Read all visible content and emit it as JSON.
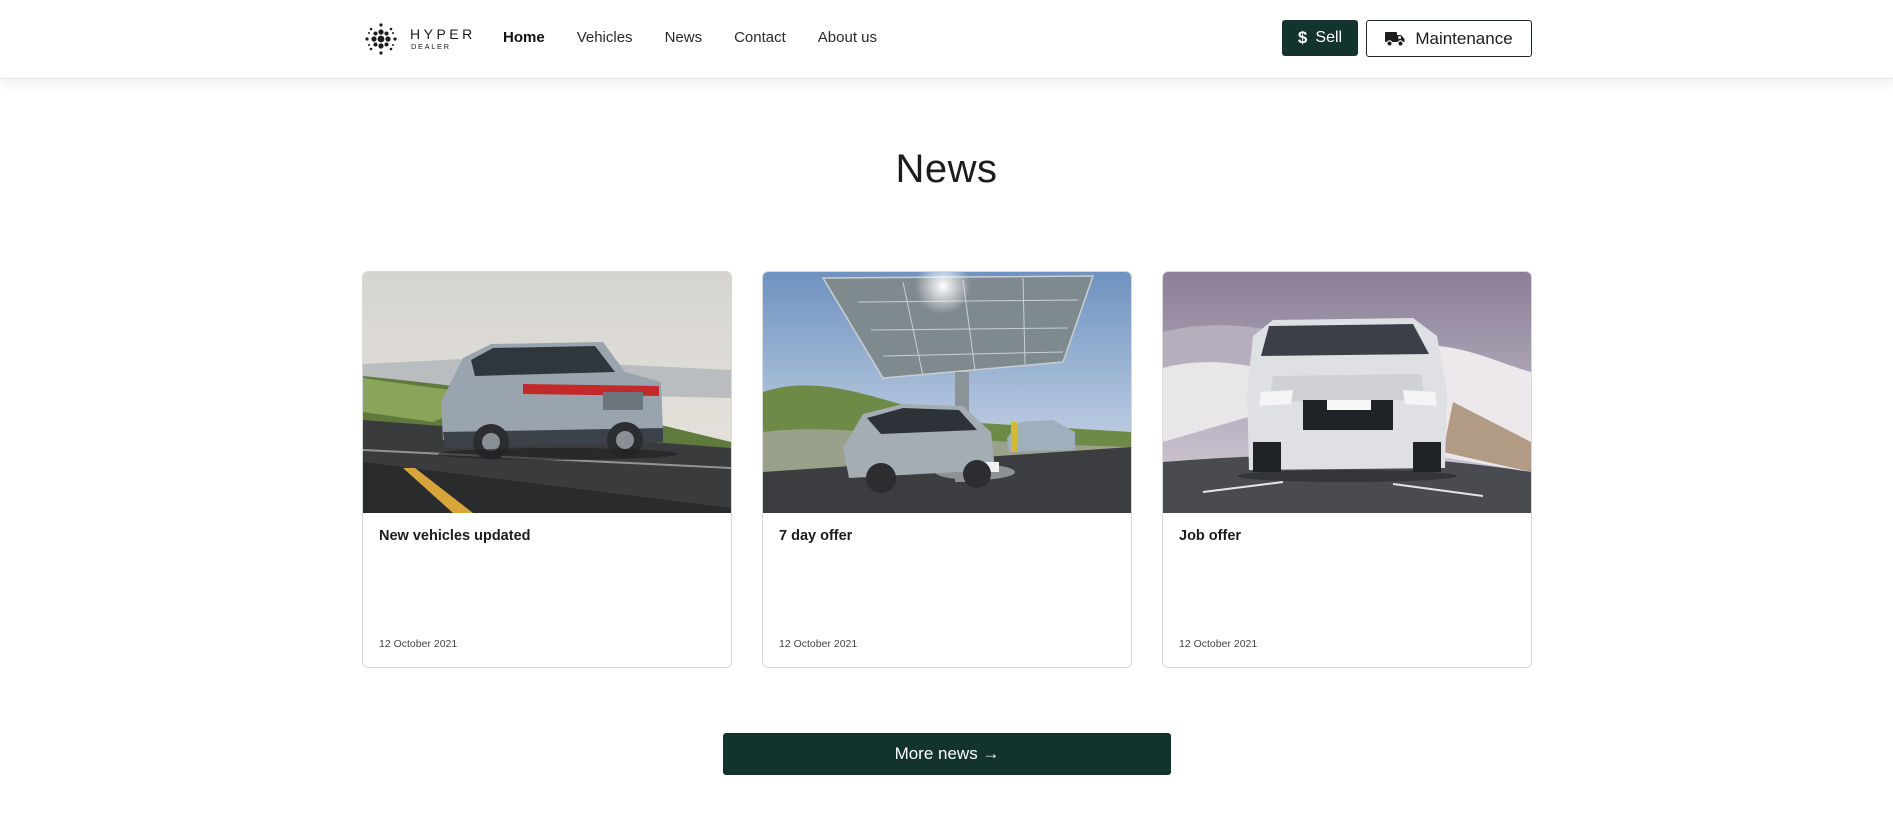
{
  "brand": {
    "name": "HYPER",
    "sub": "DEALER"
  },
  "nav": {
    "items": [
      {
        "label": "Home",
        "active": true
      },
      {
        "label": "Vehicles",
        "active": false
      },
      {
        "label": "News",
        "active": false
      },
      {
        "label": "Contact",
        "active": false
      },
      {
        "label": "About us",
        "active": false
      }
    ]
  },
  "header_actions": {
    "sell_label": "Sell",
    "maintenance_label": "Maintenance"
  },
  "page": {
    "title": "News"
  },
  "news": [
    {
      "title": "New vehicles updated",
      "date": "12 October 2021",
      "image": "suv-on-coastal-road"
    },
    {
      "title": "7 day offer",
      "date": "12 October 2021",
      "image": "electric-car-solar-charging"
    },
    {
      "title": "Job offer",
      "date": "12 October 2021",
      "image": "range-rover-snowy-road"
    }
  ],
  "more_news": {
    "label": "More news →"
  },
  "colors": {
    "accent": "#12332e",
    "border": "#d9d9d9",
    "text": "#1c1c1c"
  }
}
